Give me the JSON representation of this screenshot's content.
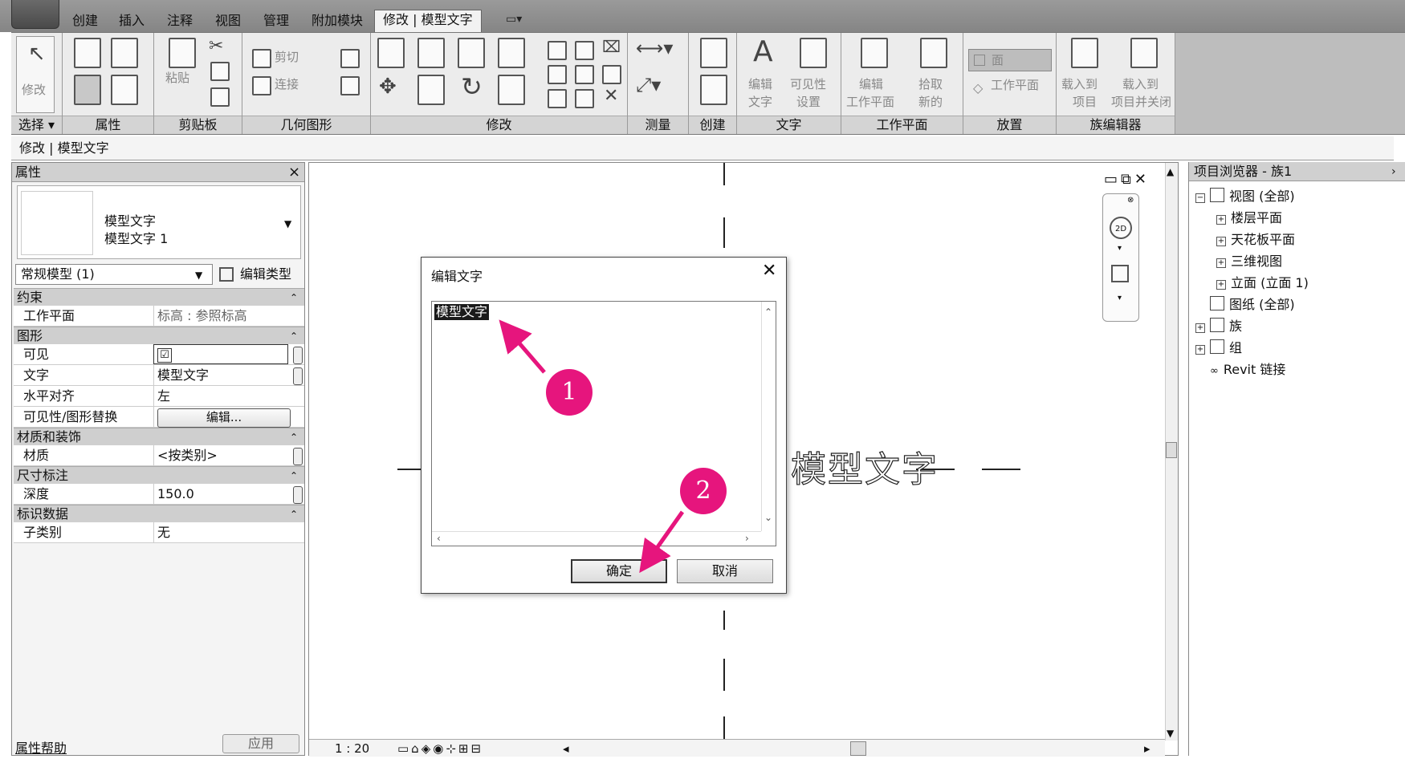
{
  "ribbon_tabs": [
    "创建",
    "插入",
    "注释",
    "视图",
    "管理",
    "附加模块",
    "修改 | 模型文字"
  ],
  "ribbon_panels": {
    "select": {
      "title": "选择",
      "modify_label": "修改"
    },
    "properties": {
      "title": "属性"
    },
    "clipboard": {
      "title": "剪贴板",
      "paste_label": "粘贴"
    },
    "geometry": {
      "title": "几何图形",
      "cut_label": "剪切",
      "join_label": "连接"
    },
    "modify": {
      "title": "修改"
    },
    "measure": {
      "title": "测量"
    },
    "create": {
      "title": "创建"
    },
    "text": {
      "title": "文字",
      "edit_text_label": [
        "编辑",
        "文字"
      ],
      "visibility_label": [
        "可见性",
        "设置"
      ]
    },
    "workplane": {
      "title": "工作平面",
      "edit_workplane_label": [
        "编辑",
        "工作平面"
      ],
      "pick_new_label": [
        "拾取",
        "新的"
      ]
    },
    "placement": {
      "title": "放置",
      "face_label": "面",
      "workplane_label": "工作平面"
    },
    "family_editor": {
      "title": "族编辑器",
      "load_label": [
        "载入到",
        "项目"
      ],
      "load_close_label": [
        "载入到",
        "项目并关闭"
      ]
    }
  },
  "context_bar": "修改 | 模型文字",
  "properties": {
    "header": "属性",
    "type_name_line1": "模型文字",
    "type_name_line2": "模型文字 1",
    "filter": "常规模型 (1)",
    "edit_type_label": "编辑类型",
    "groups": [
      {
        "name": "约束",
        "rows": [
          {
            "key": "工作平面",
            "value": "标高 : 参照标高"
          }
        ]
      },
      {
        "name": "图形",
        "rows": [
          {
            "key": "可见",
            "value": "☑"
          },
          {
            "key": "文字",
            "value": "模型文字"
          },
          {
            "key": "水平对齐",
            "value": "左"
          },
          {
            "key": "可见性/图形替换",
            "value": "编辑..."
          }
        ]
      },
      {
        "name": "材质和装饰",
        "rows": [
          {
            "key": "材质",
            "value": "<按类别>"
          }
        ]
      },
      {
        "name": "尺寸标注",
        "rows": [
          {
            "key": "深度",
            "value": "150.0"
          }
        ]
      },
      {
        "name": "标识数据",
        "rows": [
          {
            "key": "子类别",
            "value": "无"
          }
        ]
      }
    ],
    "help_link": "属性帮助",
    "apply_label": "应用"
  },
  "canvas": {
    "model_text": "模型文字",
    "scale": "1 : 20"
  },
  "dialog": {
    "title": "编辑文字",
    "text_value": "模型文字",
    "ok_label": "确定",
    "cancel_label": "取消"
  },
  "browser": {
    "header": "项目浏览器 - 族1",
    "items": [
      "视图 (全部)",
      "楼层平面",
      "天花板平面",
      "三维视图",
      "立面 (立面 1)",
      "图纸 (全部)",
      "族",
      "组",
      "Revit 链接"
    ]
  },
  "annotations": {
    "marker1": "1",
    "marker2": "2",
    "color": "#e6157d"
  }
}
